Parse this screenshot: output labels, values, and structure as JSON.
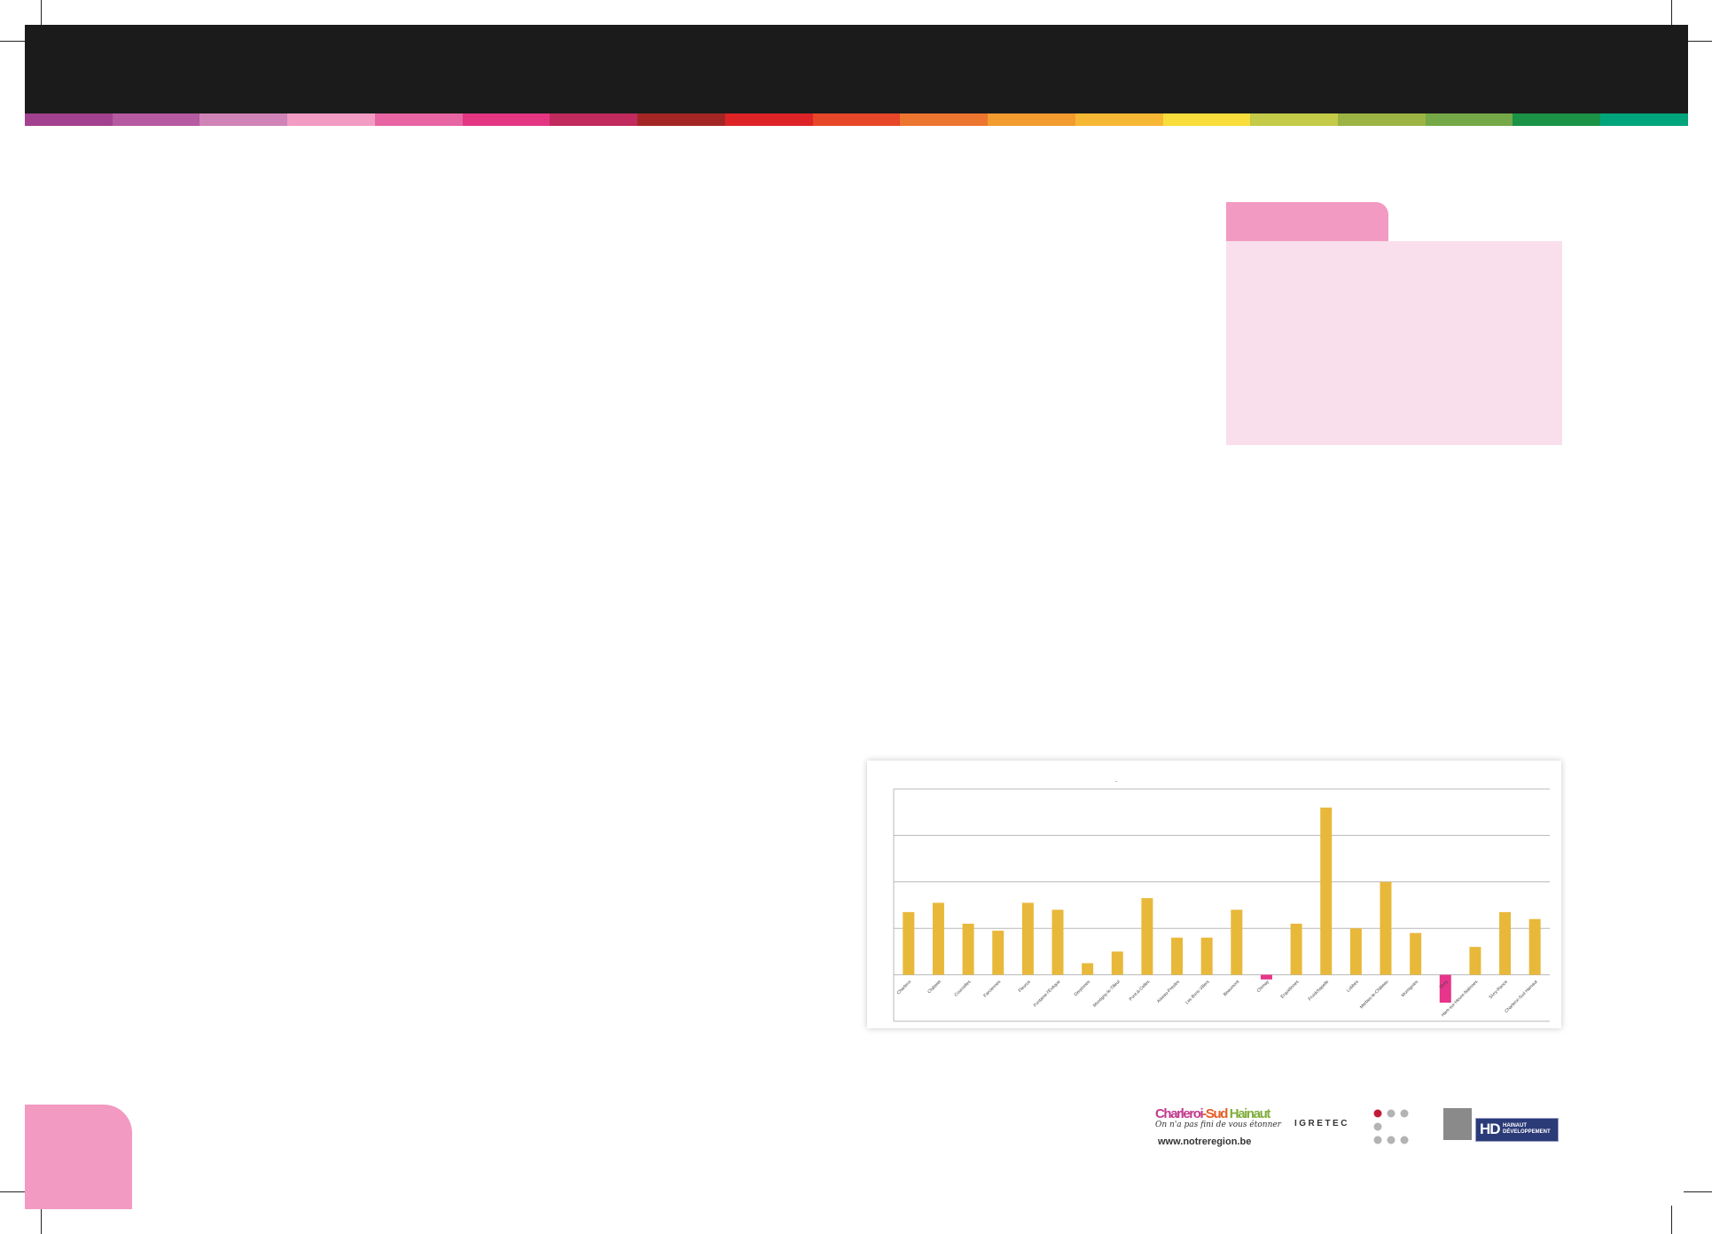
{
  "header": {
    "strip_colors": [
      "#a2418f",
      "#b65aa2",
      "#d083b7",
      "#f29cc3",
      "#e765a3",
      "#e33582",
      "#c12a5c",
      "#a42624",
      "#de2326",
      "#e84628",
      "#ec7530",
      "#f29b2e",
      "#f6b834",
      "#f9dd3a",
      "#c3cb48",
      "#9cb443",
      "#75a947",
      "#1a9346",
      "#00a57c"
    ]
  },
  "info_box": {
    "tab_color": "#f29ac2",
    "panel_color": "#f9dfeb"
  },
  "chart_data": {
    "type": "bar",
    "title": ".",
    "categories": [
      "Charleroi",
      "Châtelet",
      "Courcelles",
      "Farciennes",
      "Fleurus",
      "Fontaine-l'Evêque",
      "Gerpinnes",
      "Montigny-le-Tilleul",
      "Pont-à-Celles",
      "Aiseau-Presles",
      "Les Bons Villers",
      "Beaumont",
      "Chimay",
      "Erquelinnes",
      "Froidchapelle",
      "Lobbes",
      "Merbes-le-Château",
      "Momignies",
      "Sivry",
      "Ham-sur-Heure-Nalinnes",
      "Sivry-Rance",
      "Charleroi-Sud Hainaut"
    ],
    "values": [
      27,
      31,
      22,
      19,
      31,
      28,
      5,
      10,
      33,
      16,
      16,
      28,
      -2,
      22,
      72,
      20,
      40,
      18,
      -12,
      12,
      27,
      24
    ],
    "ylim": [
      -20,
      80
    ],
    "gridlines": 5,
    "grid": true,
    "bar_color": "#e8b83a",
    "negative_bar_color": "#e6358a",
    "gridline_color": "#b8b8b8"
  },
  "page_tab": {
    "color": "#f29ac2"
  },
  "logos": {
    "csh_part1": "Charleroi",
    "csh_part2": "-Sud ",
    "csh_part3": "Hainaut",
    "csh_tagline": "On n'a pas fini de vous étonner",
    "website": "www.notreregion.be",
    "igretec": "IGRETEC",
    "hd_mark": "HD",
    "hd_line1": "HAINAUT",
    "hd_line2": "DÉVELOPPEMENT"
  }
}
